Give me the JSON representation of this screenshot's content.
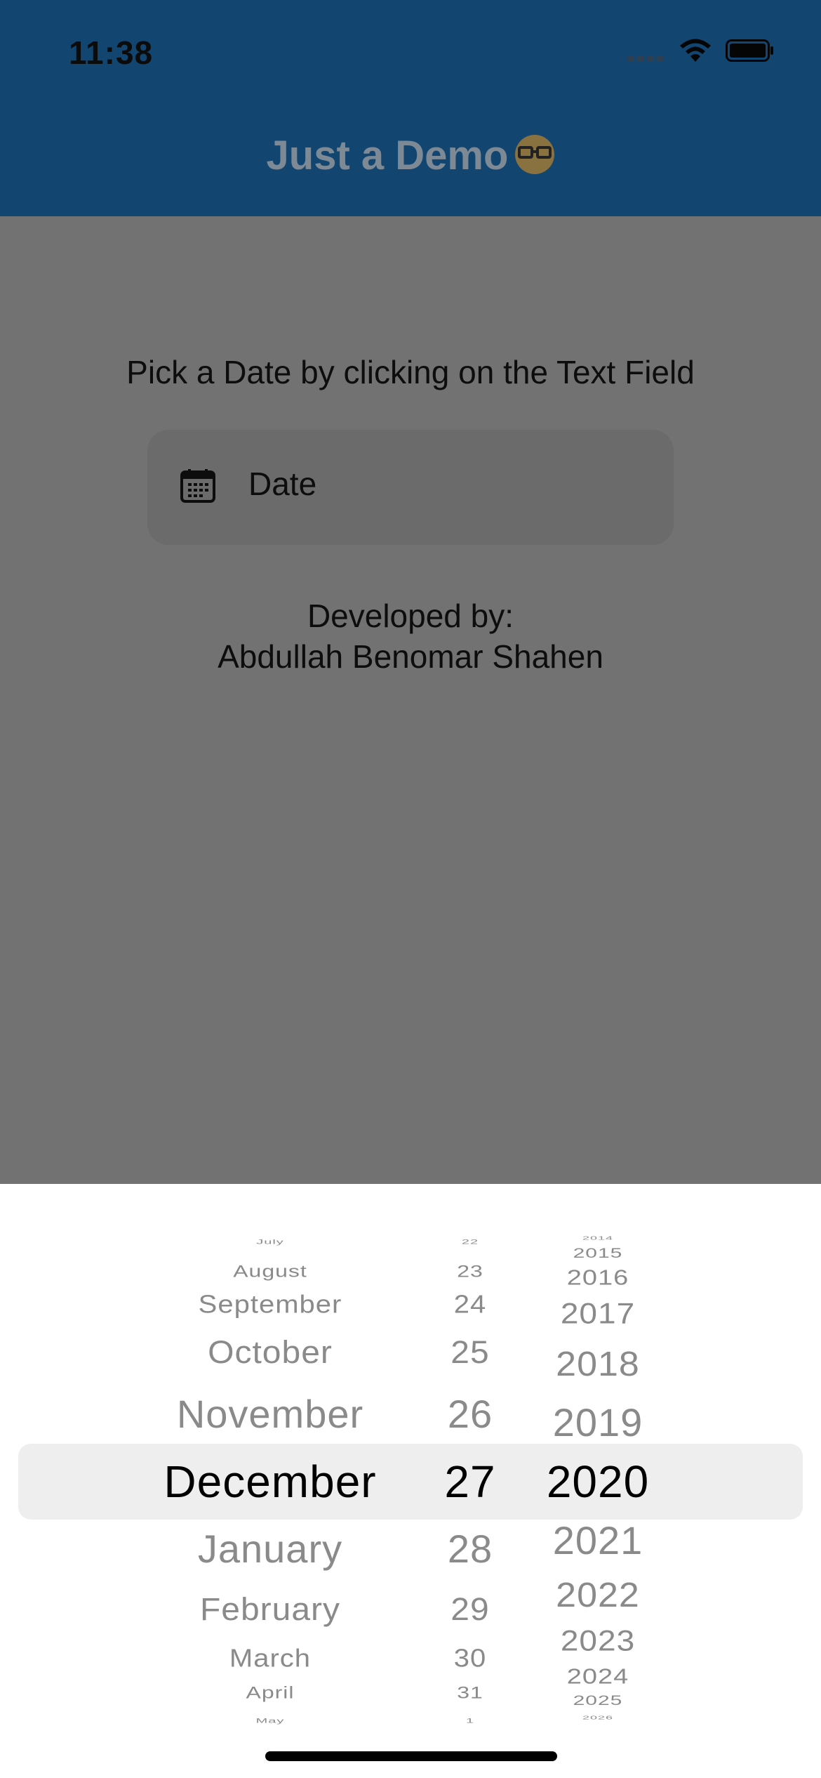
{
  "status_bar": {
    "time": "11:38"
  },
  "app_bar": {
    "title": "Just a Demo",
    "emoji_icon": "nerd-face-emoji"
  },
  "main": {
    "prompt": "Pick a Date by clicking on the Text Field",
    "date_field": {
      "label": "Date",
      "icon": "calendar-icon"
    },
    "developer_line1": "Developed by:",
    "developer_line2": "Abdullah Benomar Shahen"
  },
  "date_picker": {
    "months": [
      "July",
      "August",
      "September",
      "October",
      "November",
      "December",
      "January",
      "February",
      "March",
      "April",
      "May"
    ],
    "days": [
      "22",
      "23",
      "24",
      "25",
      "26",
      "27",
      "28",
      "29",
      "30",
      "31",
      "1"
    ],
    "years": [
      "2014",
      "2015",
      "2016",
      "2017",
      "2018",
      "2019",
      "2020",
      "2021",
      "2022",
      "2023",
      "2024",
      "2025",
      "2026"
    ],
    "selected": {
      "month": "December",
      "day": "27",
      "year": "2020"
    }
  },
  "colors": {
    "app_bar": "#124670",
    "overlay_body": "#727272",
    "picker_highlight": "#eeeeee"
  }
}
